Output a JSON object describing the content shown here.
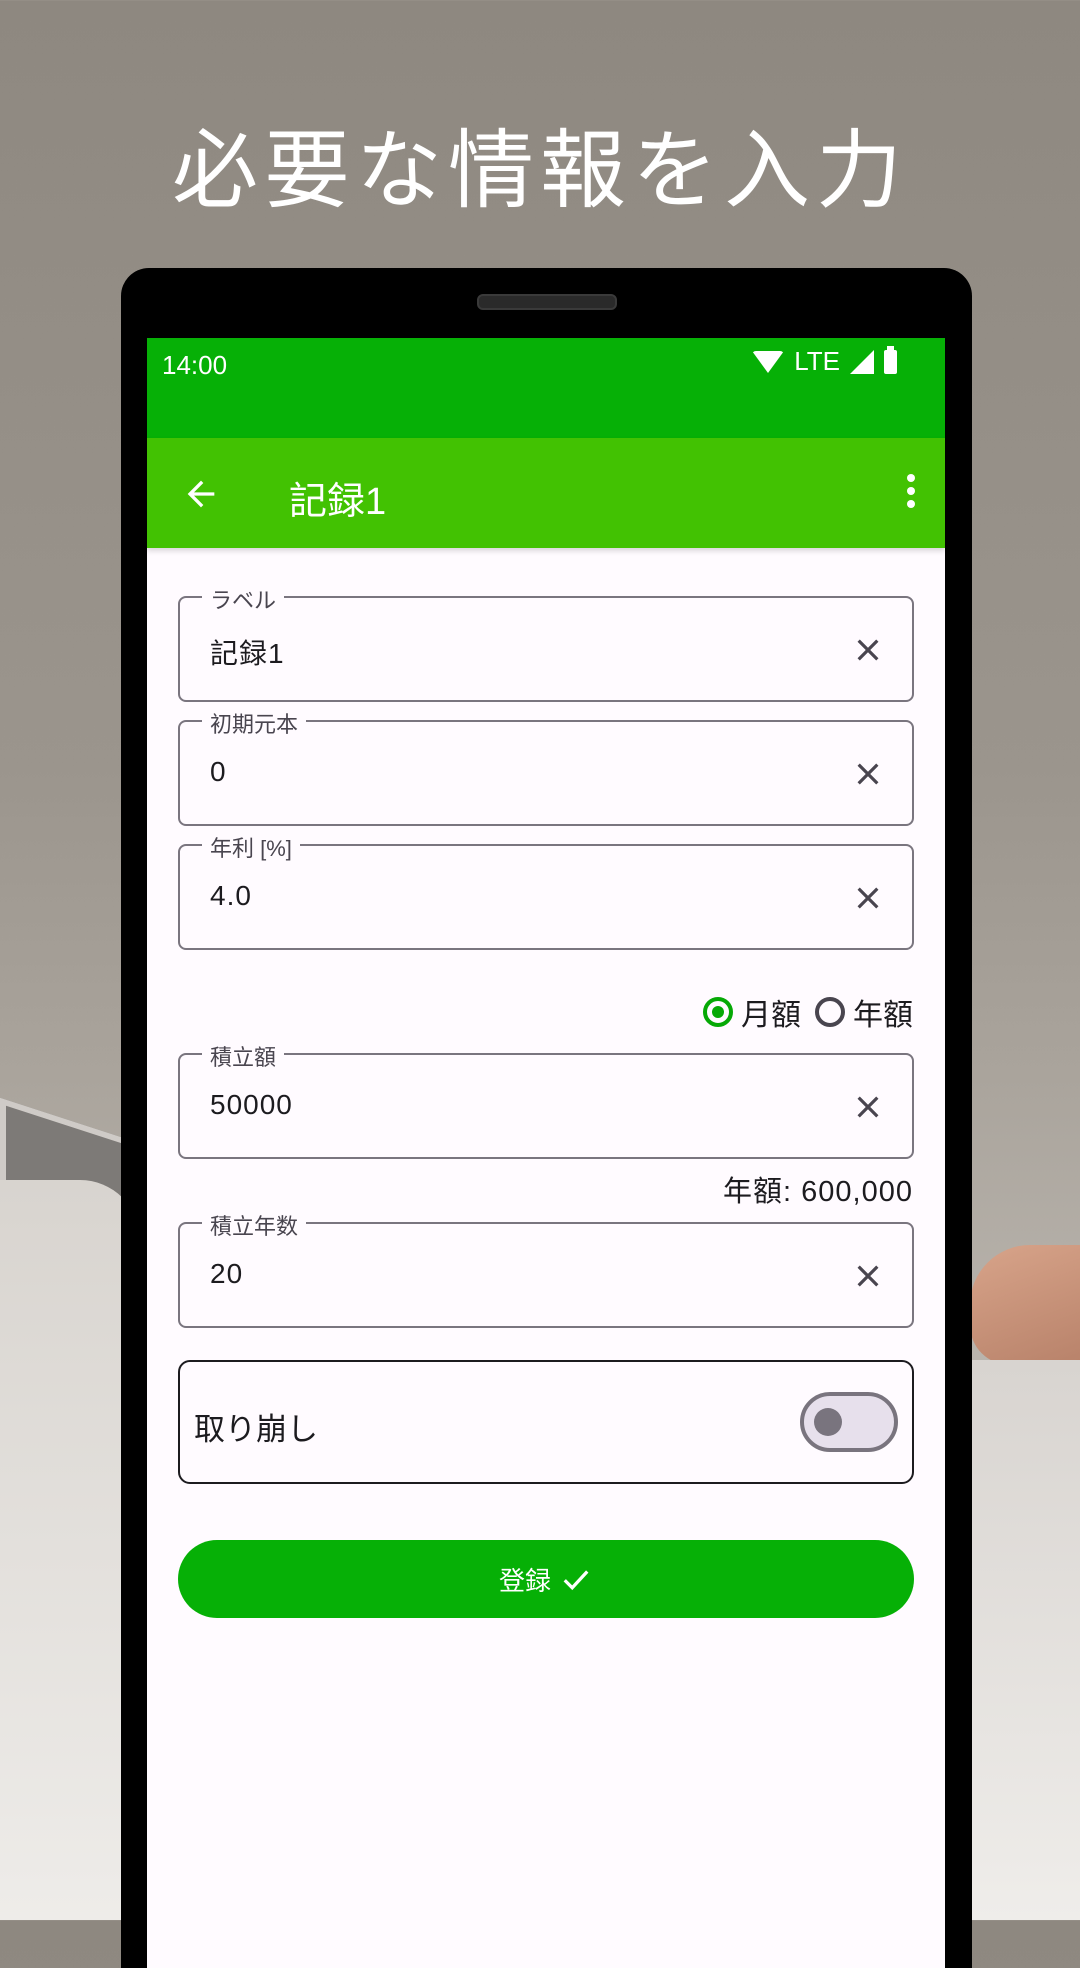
{
  "headline": "必要な情報を入力",
  "status": {
    "time": "14:00",
    "network": "LTE"
  },
  "appbar": {
    "title": "記録1"
  },
  "fields": [
    {
      "label": "ラベル",
      "value": "記録1"
    },
    {
      "label": "初期元本",
      "value": "0"
    },
    {
      "label": "年利 [%]",
      "value": "4.0"
    },
    {
      "label": "積立額",
      "value": "50000"
    },
    {
      "label": "積立年数",
      "value": "20"
    }
  ],
  "frequency": {
    "options": [
      "月額",
      "年額"
    ],
    "selected": "月額"
  },
  "annual_note": "年額: 600,000",
  "withdraw": {
    "label": "取り崩し",
    "on": false
  },
  "submit_label": "登録",
  "colors": {
    "statusbar": "#06b006",
    "appbar": "#42c202",
    "accent": "#06a906"
  }
}
